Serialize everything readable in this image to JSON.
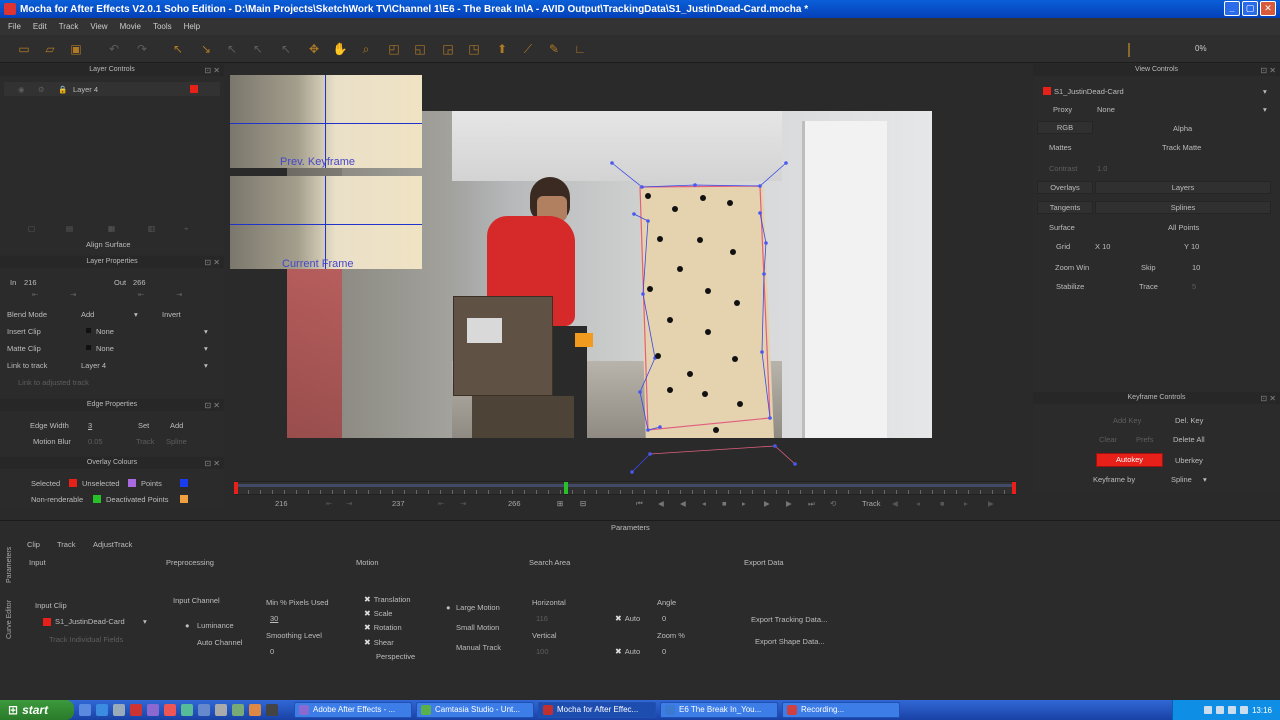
{
  "window": {
    "title": "Mocha for After Effects V2.0.1 Soho Edition - D:\\Main Projects\\SketchWork TV\\Channel 1\\E6 - The Break In\\A - AVID Output\\TrackingData\\S1_JustinDead-Card.mocha *"
  },
  "menu": [
    "File",
    "Edit",
    "Track",
    "View",
    "Movie",
    "Tools",
    "Help"
  ],
  "toolbar": {
    "progress": "0%"
  },
  "layer_controls": {
    "title": "Layer Controls",
    "layer_name": "Layer 4",
    "layer_color": "#e8201a",
    "align_surface": "Align Surface"
  },
  "layer_properties": {
    "title": "Layer Properties",
    "in_label": "In",
    "in_value": "216",
    "out_label": "Out",
    "out_value": "266",
    "blend_mode_label": "Blend Mode",
    "blend_mode_value": "Add",
    "invert": "Invert",
    "insert_clip_label": "Insert Clip",
    "insert_clip_value": "None",
    "matte_clip_label": "Matte Clip",
    "matte_clip_value": "None",
    "link_to_track_label": "Link to track",
    "link_to_track_value": "Layer 4",
    "link_adjusted": "Link to adjusted track"
  },
  "edge_properties": {
    "title": "Edge Properties",
    "edge_width_label": "Edge Width",
    "edge_width_value": "3",
    "set": "Set",
    "add": "Add",
    "motion_blur_label": "Motion Blur",
    "motion_blur_value": "0.05",
    "track": "Track",
    "spline": "Spline"
  },
  "overlay_colours": {
    "title": "Overlay Colours",
    "selected": "Selected",
    "selected_color": "#e8201a",
    "unselected": "Unselected",
    "unselected_color": "#a868e0",
    "points": "Points",
    "points_color": "#1a3cf0",
    "non_renderable": "Non-renderable",
    "non_renderable_color": "#28c028",
    "deactivated_points": "Deactivated Points",
    "deactivated_color": "#f0a040"
  },
  "viewer": {
    "prev_keyframe": "Prev. Keyframe",
    "current_frame": "Current Frame"
  },
  "timeline": {
    "start": "216",
    "current": "237",
    "end": "266",
    "track_label": "Track"
  },
  "view_controls": {
    "title": "View Controls",
    "clip_name": "S1_JustinDead-Card",
    "clip_color": "#e8201a",
    "proxy_label": "Proxy",
    "proxy_value": "None",
    "rgb": "RGB",
    "alpha": "Alpha",
    "mattes": "Mattes",
    "track_matte": "Track Matte",
    "contrast_label": "Contrast",
    "contrast_value": "1.0",
    "overlays": "Overlays",
    "layers": "Layers",
    "tangents": "Tangents",
    "splines": "Splines",
    "surface": "Surface",
    "all_points": "All Points",
    "grid": "Grid",
    "grid_x": "X 10",
    "grid_y": "Y 10",
    "zoom_win": "Zoom Win",
    "skip": "Skip",
    "skip_value": "10",
    "stabilize": "Stabilize",
    "trace": "Trace",
    "trace_value": "5"
  },
  "keyframe_controls": {
    "title": "Keyframe Controls",
    "add_key": "Add Key",
    "del_key": "Del. Key",
    "clear": "Clear",
    "prefs": "Prefs",
    "delete_all": "Delete All",
    "autokey": "Autokey",
    "uberkey": "Uberkey",
    "keyframe_by_label": "Keyframe by",
    "keyframe_by_value": "Spline",
    "autokey_color": "#e8201a"
  },
  "parameters": {
    "title": "Parameters",
    "tabs": [
      "Clip",
      "Track",
      "AdjustTrack"
    ],
    "side_tabs": [
      "Parameters",
      "Curve Editor"
    ],
    "input": {
      "title": "Input",
      "input_clip_label": "Input Clip",
      "input_clip_value": "S1_JustinDead-Card",
      "track_individual": "Track Individual Fields"
    },
    "preprocessing": {
      "title": "Preprocessing",
      "input_channel": "Input Channel",
      "luminance": "Luminance",
      "auto_channel": "Auto Channel",
      "min_pixels_label": "Min % Pixels Used",
      "min_pixels_value": "30",
      "smoothing_label": "Smoothing Level",
      "smoothing_value": "0"
    },
    "motion": {
      "title": "Motion",
      "translation": "Translation",
      "scale": "Scale",
      "rotation": "Rotation",
      "shear": "Shear",
      "perspective": "Perspective",
      "large_motion": "Large Motion",
      "small_motion": "Small Motion",
      "manual_track": "Manual Track"
    },
    "search_area": {
      "title": "Search Area",
      "horizontal": "Horizontal",
      "horizontal_value": "116",
      "vertical": "Vertical",
      "vertical_value": "100",
      "auto": "Auto",
      "angle": "Angle",
      "angle_value": "0",
      "zoom": "Zoom %",
      "zoom_value": "0"
    },
    "export_data": {
      "title": "Export Data",
      "export_tracking": "Export Tracking Data...",
      "export_shape": "Export Shape Data..."
    }
  },
  "taskbar": {
    "start": "start",
    "tasks": [
      {
        "label": "Adobe After Effects - ...",
        "color": "#8a6ad0"
      },
      {
        "label": "Camtasia Studio - Unt...",
        "color": "#5ab04a"
      },
      {
        "label": "Mocha for After Effec...",
        "color": "#c03030"
      },
      {
        "label": "E6 The Break In_You...",
        "color": "#3a7ad0"
      },
      {
        "label": "Recording...",
        "color": "#d04040"
      }
    ],
    "clock": "13:16"
  }
}
